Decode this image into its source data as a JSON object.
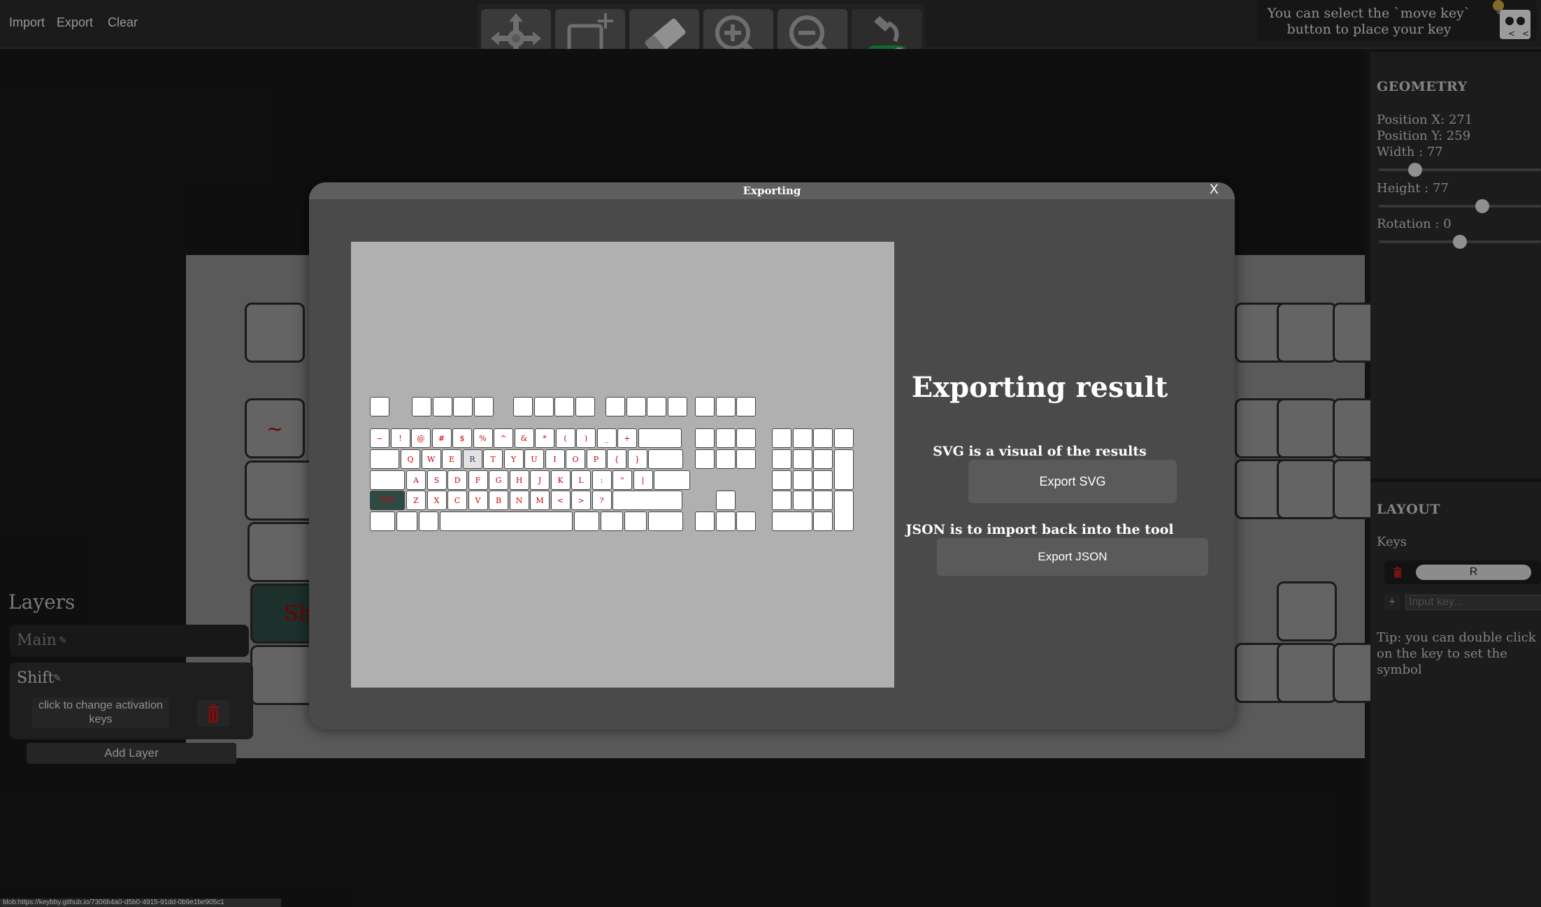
{
  "menu": {
    "import": "Import",
    "export": "Export",
    "clear": "Clear"
  },
  "hint": {
    "text": "You can select the `move key` button to place your key"
  },
  "canvas": {
    "shift_label": "Shi",
    "tilde": "~"
  },
  "geometry": {
    "title": "GEOMETRY",
    "pos_x": "Position X: 271",
    "pos_y": "Position Y: 259",
    "width": "Width : 77",
    "height": "Height : 77",
    "rotation": "Rotation : 0",
    "width_level": 0.2,
    "height_level": 0.65,
    "rotation_level": 0.5
  },
  "layout": {
    "title": "LAYOUT",
    "keys_label": "Keys",
    "key_value": "R",
    "add": "+",
    "input_placeholder": "Input key...",
    "tip": "Tip: you can double click on the key to set the symbol"
  },
  "layers": {
    "title": "Layers",
    "main": "Main",
    "shift": "Shift",
    "activation": "click to change activation keys",
    "add": "Add Layer"
  },
  "modal": {
    "title": "Exporting",
    "close": "X",
    "result_title": "Exporting result",
    "svg_desc": "SVG is a visual of the results",
    "svg_btn": "Export SVG",
    "json_desc": "JSON is to import back into the tool",
    "json_btn": "Export JSON"
  },
  "preview_keys": {
    "row1": [
      "~",
      "!",
      "@",
      "#",
      "$",
      "%",
      "^",
      "&",
      "*",
      "(",
      ")",
      "_",
      "+"
    ],
    "row2": [
      "Q",
      "W",
      "E",
      "R",
      "T",
      "Y",
      "U",
      "I",
      "O",
      "P",
      "{",
      "}"
    ],
    "row3": [
      "A",
      "S",
      "D",
      "F",
      "G",
      "H",
      "J",
      "K",
      "L",
      ":",
      "\"",
      "|"
    ],
    "row4_shift": "Shift",
    "row4": [
      "Z",
      "X",
      "C",
      "V",
      "B",
      "N",
      "M",
      "<",
      ">",
      "?"
    ]
  },
  "status_bar": "blob:https://keybby.github.io/7306b4a0-d5b0-4915-91dd-0b9e1be905c1",
  "colors": {
    "accent_red": "#cc0000",
    "toggle_green": "#1e9e4a"
  }
}
